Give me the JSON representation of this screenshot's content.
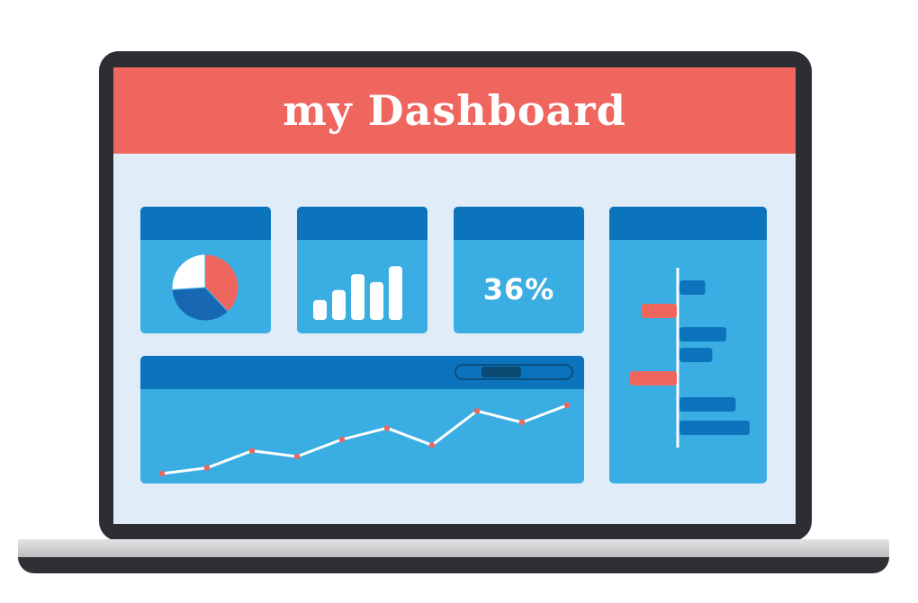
{
  "dashboard": {
    "title": "my  Dashboard"
  },
  "widgets": {
    "pie": {
      "icon": "pie-chart-icon",
      "slices_pct": [
        38,
        36,
        26
      ],
      "slice_colors": [
        "#ef665f",
        "#1867b2",
        "#ffffff"
      ]
    },
    "bars": {
      "icon": "bar-chart-icon",
      "values": [
        1,
        1.5,
        2.3,
        1.9,
        2.7
      ]
    },
    "stat": {
      "value": "36%"
    },
    "line": {
      "values": [
        1,
        2,
        5,
        4,
        7,
        9,
        6,
        12,
        10,
        13
      ],
      "scroll_position": 0.33
    },
    "hbars": {
      "values": [
        -3,
        2.2,
        -2,
        4,
        2.8,
        6.2,
        2.9,
        2.0,
        3.0
      ],
      "series": [
        {
          "value": 2.2,
          "color": "#0c74bc"
        },
        {
          "value": -3.0,
          "color": "#ef665f"
        },
        {
          "value": 4.0,
          "color": "#0c74bc"
        },
        {
          "value": 2.8,
          "color": "#0c74bc"
        },
        {
          "value": -4.0,
          "color": "#ef665f"
        },
        {
          "value": 4.8,
          "color": "#0c74bc"
        },
        {
          "value": 6.0,
          "color": "#0c74bc"
        }
      ]
    }
  },
  "colors": {
    "header": "#ef665f",
    "panel": "#3aaee3",
    "panel_bar": "#0c74bc",
    "screen_bg": "#e0edf8",
    "accent": "#ef665f"
  }
}
